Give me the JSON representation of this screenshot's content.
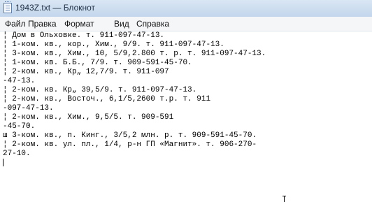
{
  "window": {
    "title": "1943Z.txt — Блокнот",
    "icon": "notepad-icon"
  },
  "menu": {
    "items": [
      "Файл",
      "Правка",
      "Формат",
      "Вид",
      "Справка"
    ]
  },
  "document": {
    "lines": [
      "¦ Дом в Ольховке. т. 911-097-47-13.",
      "¦ 1-ком. кв., кор., Хим., 9/9. т. 911-097-47-13.",
      "¦ 3-ком. кв., Хим., 10, 5/9,2.800 т. р. т. 911-097-47-13.",
      "¦ 1-ком. кв. Б.Б., 7/9. т. 909-591-45-70.",
      "¦ 2-ком. кв., Кр„ 12,7/9. т. 911-097",
      "-47-13.",
      "¦ 2-ком. кв. Кр„ 39,5/9. т. 911-097-47-13.",
      "¦ 2-ком. кв., Восточ., 6,1/5,2600 т.р. т. 911",
      "-097-47-13.",
      "¦ 2-ком. кв., Хим., 9,5/5. т. 909-591",
      "-45-70.",
      "ш 3-ком. кв., п. Кинг., 3/5,2 млн. р. т. 909-591-45-70.",
      "¦ 2-ком. кв. ул. пл., 1/4, р-н ГП «Магнит». т. 906-270-",
      "27-10."
    ]
  }
}
